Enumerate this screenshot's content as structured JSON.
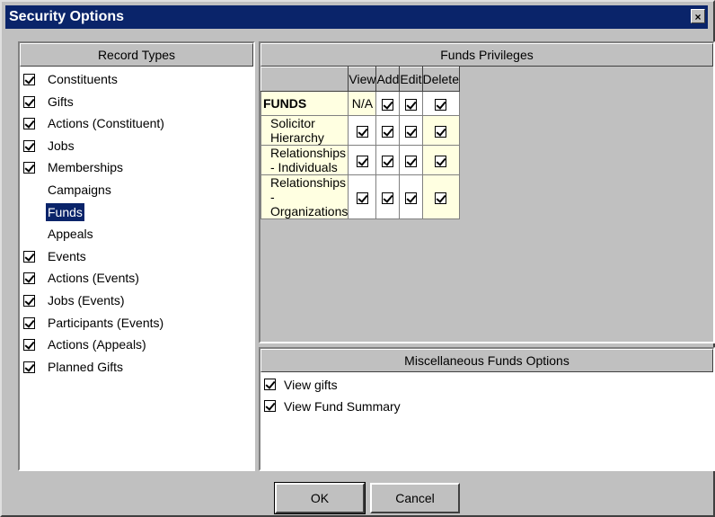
{
  "window": {
    "title": "Security Options",
    "close_glyph": "×"
  },
  "record_types": {
    "header": "Record Types",
    "items": [
      {
        "label": "Constituents",
        "checked": true
      },
      {
        "label": "Gifts",
        "checked": true
      },
      {
        "label": "Actions (Constituent)",
        "checked": true
      },
      {
        "label": "Jobs",
        "checked": true
      },
      {
        "label": "Memberships",
        "checked": true
      },
      {
        "label": "Campaigns",
        "checked": null
      },
      {
        "label": "Funds",
        "checked": null,
        "selected": true
      },
      {
        "label": "Appeals",
        "checked": null
      },
      {
        "label": "Events",
        "checked": true
      },
      {
        "label": "Actions (Events)",
        "checked": true
      },
      {
        "label": "Jobs (Events)",
        "checked": true
      },
      {
        "label": "Participants (Events)",
        "checked": true
      },
      {
        "label": "Actions (Appeals)",
        "checked": true
      },
      {
        "label": "Planned Gifts",
        "checked": true
      }
    ]
  },
  "privileges": {
    "header": "Funds Privileges",
    "columns": [
      "View",
      "Add",
      "Edit",
      "Delete"
    ],
    "rows": [
      {
        "name": "FUNDS",
        "group": true,
        "view": "N/A",
        "add": true,
        "edit": true,
        "delete": true
      },
      {
        "name": "Solicitor Hierarchy",
        "view": true,
        "add": true,
        "edit": true,
        "delete": true
      },
      {
        "name": "Relationships - Individuals",
        "view": true,
        "add": true,
        "edit": true,
        "delete": true
      },
      {
        "name": "Relationships - Organizations",
        "view": true,
        "add": true,
        "edit": true,
        "delete": true
      }
    ]
  },
  "misc": {
    "header": "Miscellaneous Funds Options",
    "items": [
      {
        "label": "View gifts",
        "checked": true
      },
      {
        "label": "View Fund Summary",
        "checked": true
      }
    ]
  },
  "buttons": {
    "ok": "OK",
    "cancel": "Cancel"
  }
}
